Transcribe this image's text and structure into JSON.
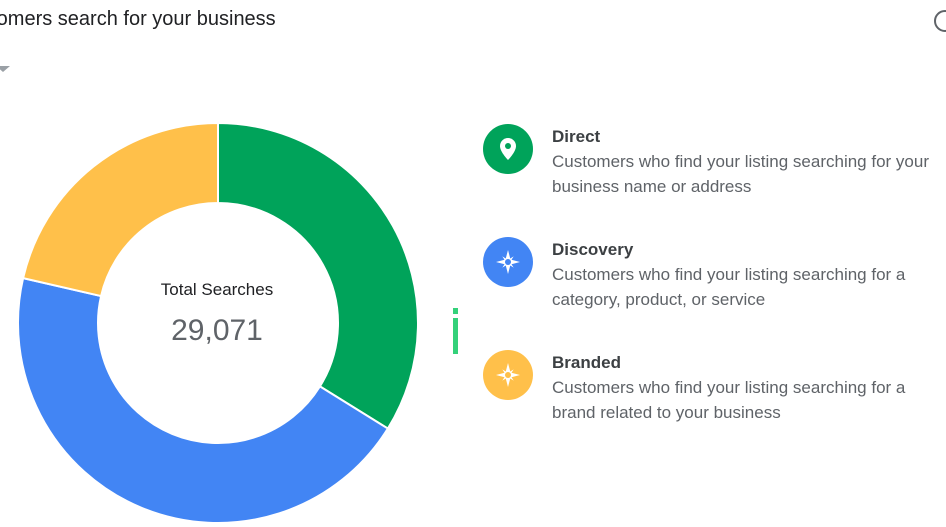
{
  "header": {
    "title": "ustomers search for your business"
  },
  "colors": {
    "direct": "#00a35a",
    "discovery": "#4285f4",
    "branded": "#ffc04a"
  },
  "chart_data": {
    "type": "pie",
    "center_label": "Total Searches",
    "total": "29,071",
    "slices": [
      {
        "name": "Direct",
        "fraction": 0.3385,
        "color": "#00a35a"
      },
      {
        "name": "Discovery",
        "fraction": 0.4475,
        "color": "#4285f4"
      },
      {
        "name": "Branded",
        "fraction": 0.214,
        "color": "#ffc04a"
      }
    ]
  },
  "legend": [
    {
      "title": "Direct",
      "description": "Customers who find your listing searching for your business name or address",
      "icon": "location-pin-icon",
      "color": "#00a35a"
    },
    {
      "title": "Discovery",
      "description": "Customers who find your listing searching for a category, product, or service",
      "icon": "compass-icon",
      "color": "#4285f4"
    },
    {
      "title": "Branded",
      "description": "Customers who find your listing searching for a brand related to your business",
      "icon": "compass-icon",
      "color": "#ffc04a"
    }
  ]
}
